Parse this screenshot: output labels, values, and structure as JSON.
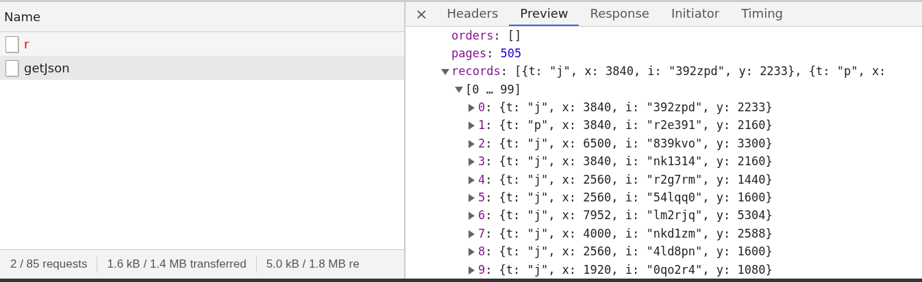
{
  "requests": {
    "column": "Name",
    "rows": [
      {
        "name": "r",
        "failed": true,
        "selected": false
      },
      {
        "name": "getJson",
        "failed": false,
        "selected": true
      }
    ]
  },
  "status_bar": [
    "2 / 85 requests",
    "1.6 kB / 1.4 MB transferred",
    "5.0 kB / 1.8 MB re"
  ],
  "details": {
    "close": "×",
    "tabs": [
      {
        "label": "Headers",
        "selected": false
      },
      {
        "label": "Preview",
        "selected": true
      },
      {
        "label": "Response",
        "selected": false
      },
      {
        "label": "Initiator",
        "selected": false
      },
      {
        "label": "Timing",
        "selected": false
      }
    ],
    "preview": [
      {
        "kind": "property",
        "key": "orders:",
        "value": "[]"
      },
      {
        "kind": "number",
        "key": "pages:",
        "value": "505"
      },
      {
        "kind": "property",
        "key": "records:",
        "value": "[{t: \"j\", x: 3840, i: \"392zpd\", y: 2233}, {t: \"p\", x:",
        "expanded": true,
        "children": [
          {
            "kind": "group",
            "key": "[0 … 99]",
            "expanded": true,
            "children": [
              {
                "kind": "property",
                "key": "0:",
                "value": "{t: \"j\", x: 3840, i: \"392zpd\", y: 2233}",
                "expanded": false
              },
              {
                "kind": "property",
                "key": "1:",
                "value": "{t: \"p\", x: 3840, i: \"r2e391\", y: 2160}",
                "expanded": false
              },
              {
                "kind": "property",
                "key": "2:",
                "value": "{t: \"j\", x: 6500, i: \"839kvo\", y: 3300}",
                "expanded": false
              },
              {
                "kind": "property",
                "key": "3:",
                "value": "{t: \"j\", x: 3840, i: \"nk1314\", y: 2160}",
                "expanded": false
              },
              {
                "kind": "property",
                "key": "4:",
                "value": "{t: \"j\", x: 2560, i: \"r2g7rm\", y: 1440}",
                "expanded": false
              },
              {
                "kind": "property",
                "key": "5:",
                "value": "{t: \"j\", x: 2560, i: \"54lqq0\", y: 1600}",
                "expanded": false
              },
              {
                "kind": "property",
                "key": "6:",
                "value": "{t: \"j\", x: 7952, i: \"lm2rjq\", y: 5304}",
                "expanded": false
              },
              {
                "kind": "property",
                "key": "7:",
                "value": "{t: \"j\", x: 4000, i: \"nkd1zm\", y: 2588}",
                "expanded": false
              },
              {
                "kind": "property",
                "key": "8:",
                "value": "{t: \"j\", x: 2560, i: \"4ld8pn\", y: 1600}",
                "expanded": false
              },
              {
                "kind": "property",
                "key": "9:",
                "value": "{t: \"j\", x: 1920, i: \"0qo2r4\", y: 1080}",
                "expanded": false
              }
            ]
          }
        ]
      }
    ]
  }
}
